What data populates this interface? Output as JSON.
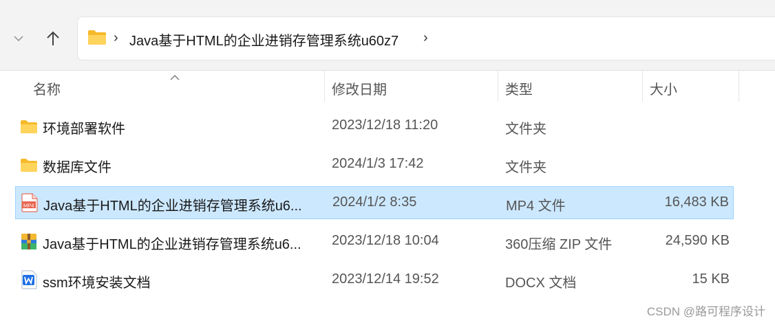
{
  "address": {
    "separator": "›",
    "path": "Java基于HTML的企业进销存管理系统u60z7",
    "trailing": "›"
  },
  "columns": {
    "name": "名称",
    "date": "修改日期",
    "type": "类型",
    "size": "大小"
  },
  "rows": [
    {
      "icon": "folder-icon",
      "name": "环境部署软件",
      "date": "2023/12/18 11:20",
      "type": "文件夹",
      "size": ""
    },
    {
      "icon": "folder-icon",
      "name": "数据库文件",
      "date": "2024/1/3 17:42",
      "type": "文件夹",
      "size": ""
    },
    {
      "icon": "mp4-file-icon",
      "name": "Java基于HTML的企业进销存管理系统u6...",
      "date": "2024/1/2 8:35",
      "type": "MP4 文件",
      "size": "16,483 KB",
      "selected": true
    },
    {
      "icon": "zip-archive-icon",
      "name": "Java基于HTML的企业进销存管理系统u6...",
      "date": "2023/12/18 10:04",
      "type": "360压缩 ZIP 文件",
      "size": "24,590 KB"
    },
    {
      "icon": "word-document-icon",
      "name": "ssm环境安装文档",
      "date": "2023/12/14 19:52",
      "type": "DOCX 文档",
      "size": "15 KB"
    }
  ],
  "watermark": "CSDN @路可程序设计",
  "colors": {
    "selection": "#cce8ff",
    "selection_border": "#99d1ff",
    "folder": "#ffc83d"
  }
}
